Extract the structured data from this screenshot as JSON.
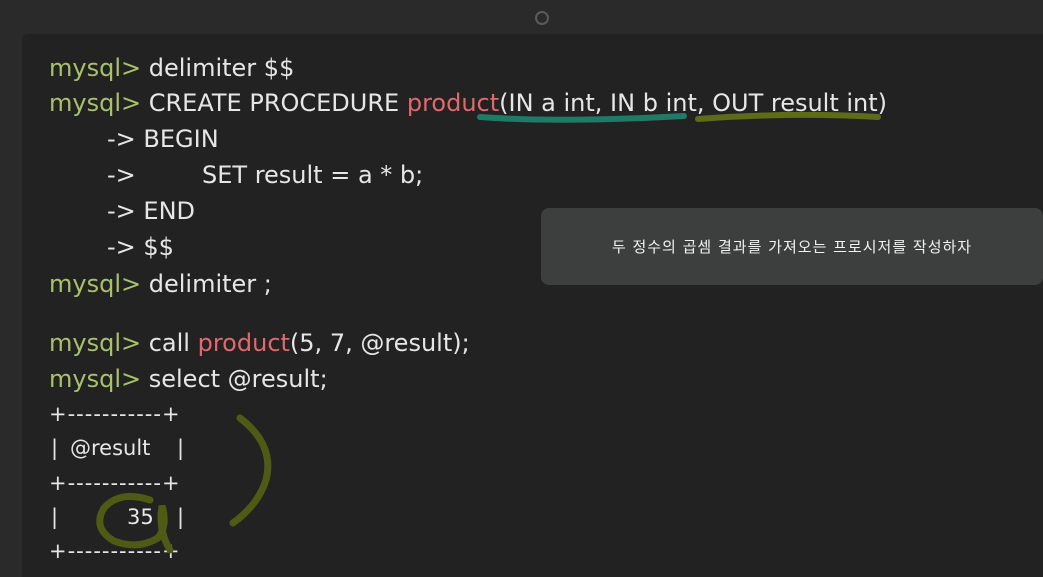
{
  "terminal": {
    "prompt": "mysql>",
    "lines": {
      "l1": {
        "prompt": "mysql>",
        "text": " delimiter $$"
      },
      "l2": {
        "prompt": "mysql>",
        "pre": " CREATE PROCEDURE ",
        "proc": "product",
        "args": "(IN a int, IN b int, OUT result int)"
      },
      "l3": {
        "text": "-> BEGIN"
      },
      "l4": {
        "arrow": "->",
        "text": "SET result = a * b;"
      },
      "l5": {
        "text": "-> END"
      },
      "l6": {
        "text": "-> $$"
      },
      "l7": {
        "prompt": "mysql>",
        "text": " delimiter ;"
      },
      "l8": {
        "prompt": "mysql>",
        "pre": " call ",
        "proc": "product",
        "args": "(5, 7, @result);"
      },
      "l9": {
        "prompt": "mysql>",
        "text": " select @result;"
      }
    },
    "table": {
      "border": "+-----------+",
      "header_left": "|",
      "header": "@result",
      "header_right": "|",
      "border2": "+-----------+",
      "row_left": "|",
      "value": "35",
      "row_right": "|",
      "border3": "+-----------+"
    }
  },
  "tooltip": {
    "text": "두 정수의 곱셈 결과를 가져오는 프로시저를 작성하자"
  },
  "colors": {
    "prompt": "#a9c26a",
    "procedure_name": "#e2686c",
    "text": "#e6e6e6",
    "underline_teal": "#1f7a66",
    "underline_olive": "#5e6b18",
    "annotation": "#4f5a15"
  },
  "icons": {
    "camera": "camera-dot"
  }
}
